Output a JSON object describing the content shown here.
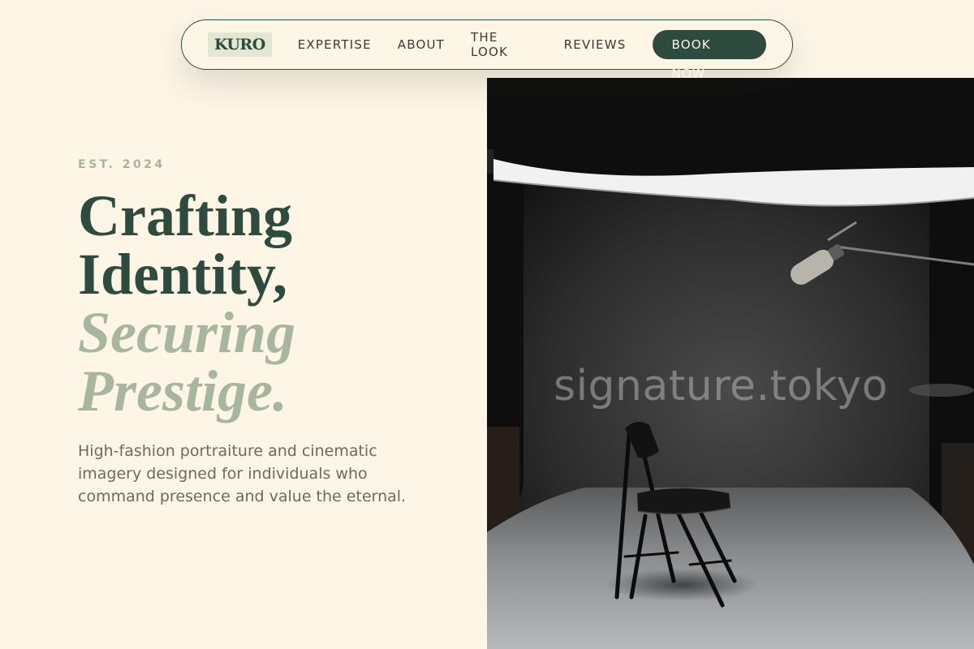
{
  "nav": {
    "logo": "KURO",
    "links": [
      "EXPERTISE",
      "ABOUT",
      "THE LOOK",
      "REVIEWS"
    ],
    "cta": "BOOK NOW"
  },
  "hero": {
    "eyebrow": "EST. 2024",
    "headline_line1": "Crafting",
    "headline_line2": "Identity,",
    "headline_accent1": "Securing",
    "headline_accent2": "Prestige.",
    "subtext": "High-fashion portraiture and cinematic imagery designed for individuals who command presence and value the eternal."
  },
  "photo": {
    "watermark": "signature.tokyo",
    "subject": "studio-chair-photo"
  },
  "colors": {
    "background": "#fdf5e6",
    "primary": "#2f4a3f",
    "accent": "#a9b69f",
    "body_text": "#6b6a62"
  }
}
